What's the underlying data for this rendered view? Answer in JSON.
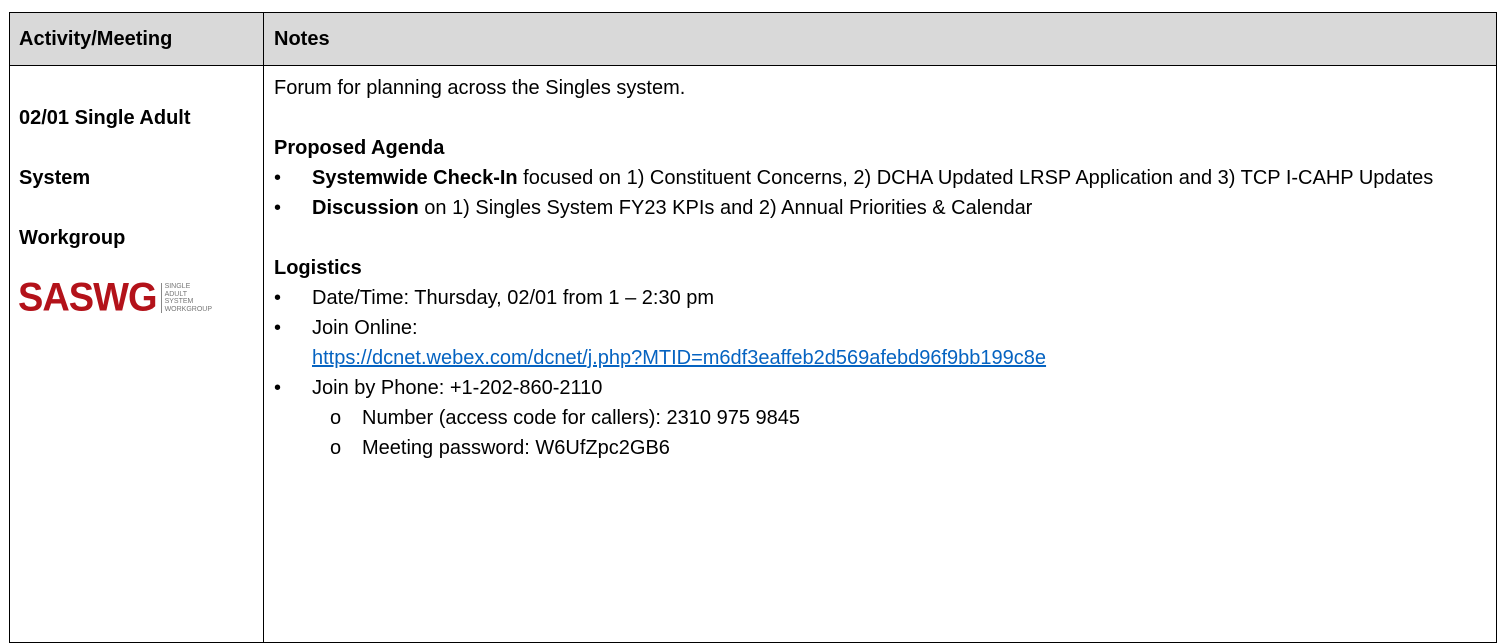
{
  "header": {
    "col1": "Activity/Meeting",
    "col2": "Notes"
  },
  "activity": {
    "title": "02/01 Single Adult System Workgroup",
    "logo_text": "SASWG",
    "logo_subtext": "SINGLE ADULT SYSTEM WORKGROUP",
    "logo_color": "#b3121a"
  },
  "notes": {
    "intro": "Forum for planning across the Singles system.",
    "agenda_heading": "Proposed Agenda",
    "agenda_items": [
      {
        "bold": "Systemwide Check-In",
        "text": " focused on 1) Constituent Concerns, 2) DCHA Updated LRSP Application and 3) TCP I-CAHP Updates"
      },
      {
        "bold": "Discussion",
        "text": " on 1) Singles System FY23 KPIs and 2) Annual Priorities & Calendar"
      }
    ],
    "logistics_heading": "Logistics",
    "date_time": "Date/Time: Thursday, 02/01 from 1 – 2:30 pm",
    "join_online_label": "Join Online:",
    "join_online_url": "https://dcnet.webex.com/dcnet/j.php?MTID=m6df3eaffeb2d569afebd96f9bb199c8e",
    "join_phone": "Join by Phone: +1-202-860-2110",
    "access_code": "Number (access code for callers): 2310 975 9845",
    "password": "Meeting password: W6UfZpc2GB6",
    "bullet_glyph": "•",
    "sub_bullet_glyph": "o",
    "link_color": "#0563c1"
  }
}
